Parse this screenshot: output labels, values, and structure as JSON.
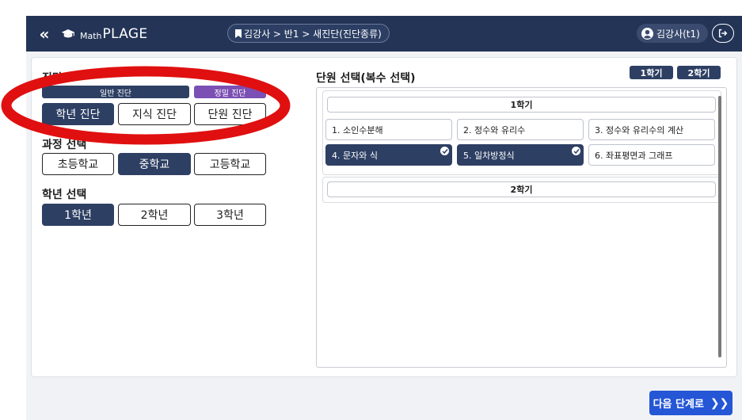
{
  "header": {
    "back_icon": "double-chevron-left-icon",
    "logo_small": "Math",
    "logo_big": "PLAGE",
    "breadcrumb": "김강사 > 반1 > 새진단(진단종류)",
    "user": "김강사(t1)"
  },
  "left": {
    "diagnosis_title": "진단",
    "diagnosis_modes": [
      {
        "label": "일반 진단",
        "color": "#2d3f63"
      },
      {
        "label": "정밀 진단",
        "color": "#7b4fb3"
      }
    ],
    "diagnosis_types": [
      {
        "label": "학년 진단",
        "active": true
      },
      {
        "label": "지식 진단",
        "active": false
      },
      {
        "label": "단원 진단",
        "active": false
      }
    ],
    "course_title": "과정 선택",
    "courses": [
      {
        "label": "초등학교",
        "active": false
      },
      {
        "label": "중학교",
        "active": true
      },
      {
        "label": "고등학교",
        "active": false
      }
    ],
    "grade_title": "학년 선택",
    "grades": [
      {
        "label": "1학년",
        "active": true
      },
      {
        "label": "2학년",
        "active": false
      },
      {
        "label": "3학년",
        "active": false
      }
    ]
  },
  "right": {
    "title": "단원 선택(복수 선택)",
    "semester_buttons": [
      "1학기",
      "2학기"
    ],
    "semesters": [
      {
        "label": "1학기",
        "units": [
          {
            "label": "1. 소인수분해",
            "selected": false
          },
          {
            "label": "2. 정수와 유리수",
            "selected": false
          },
          {
            "label": "3. 정수와 유리수의 계산",
            "selected": false
          },
          {
            "label": "4. 문자와 식",
            "selected": true
          },
          {
            "label": "5. 일차방정식",
            "selected": true
          },
          {
            "label": "6. 좌표평면과 그래프",
            "selected": false
          }
        ]
      },
      {
        "label": "2학기",
        "units": []
      }
    ]
  },
  "footer": {
    "next_label": "다음 단계로",
    "next_icon": "double-chevron-right-icon"
  },
  "colors": {
    "navy": "#233456",
    "active": "#2d3f63",
    "purple": "#7b4fb3",
    "primary_blue": "#2456d6",
    "annotation_red": "#e01010"
  }
}
